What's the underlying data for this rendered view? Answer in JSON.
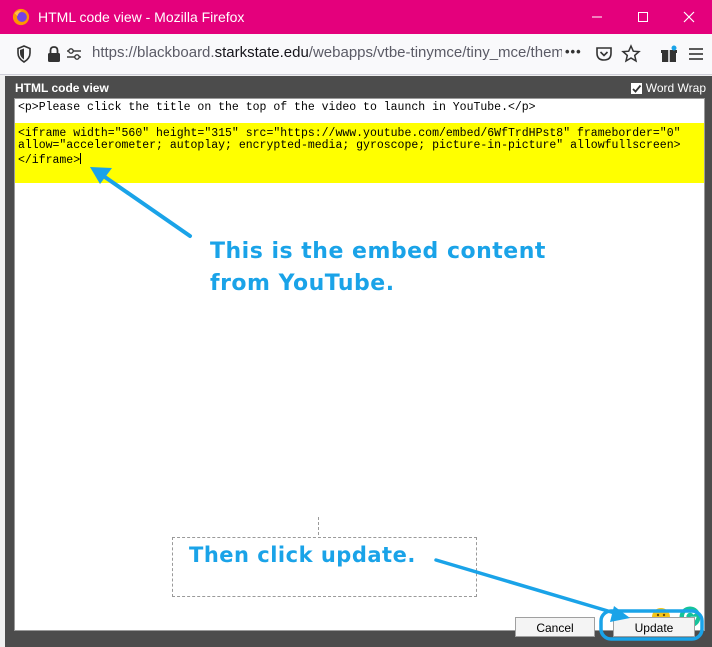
{
  "window": {
    "title": "HTML code view - Mozilla Firefox"
  },
  "urlbar": {
    "url_prefix": "https://blackboard.",
    "url_domain": "starkstate.edu",
    "url_suffix": "/webapps/vtbe-tinymce/tiny_mce/themes/ac",
    "more_label": "•••"
  },
  "dialog": {
    "title": "HTML code view",
    "word_wrap_label": "Word Wrap",
    "word_wrap_checked": true,
    "code_line1": "<p>Please click the title on the top of the video to launch in YouTube.</p>",
    "code_highlight": "<iframe width=\"560\" height=\"315\" src=\"https://www.youtube.com/embed/6WfTrdHPst8\" frameborder=\"0\"\nallow=\"accelerometer; autoplay; encrypted-media; gyroscope; picture-in-picture\" allowfullscreen>\n</iframe>",
    "cancel_label": "Cancel",
    "update_label": "Update"
  },
  "annotations": {
    "embed_note_line1": "This is the embed content",
    "embed_note_line2": "from YouTube.",
    "update_note": "Then click update."
  },
  "colors": {
    "titlebar": "#e4007c",
    "highlight": "#ffff00",
    "annotation": "#1aa3e8",
    "dialog_bg": "#4c4c4c"
  },
  "icons": [
    "firefox-logo-icon",
    "minimize-icon",
    "maximize-icon",
    "close-icon",
    "shield-icon",
    "lock-icon",
    "permissions-icon",
    "more-icon",
    "pocket-icon",
    "star-icon",
    "gift-icon",
    "menu-icon",
    "emoji-icon",
    "grammarly-icon"
  ]
}
